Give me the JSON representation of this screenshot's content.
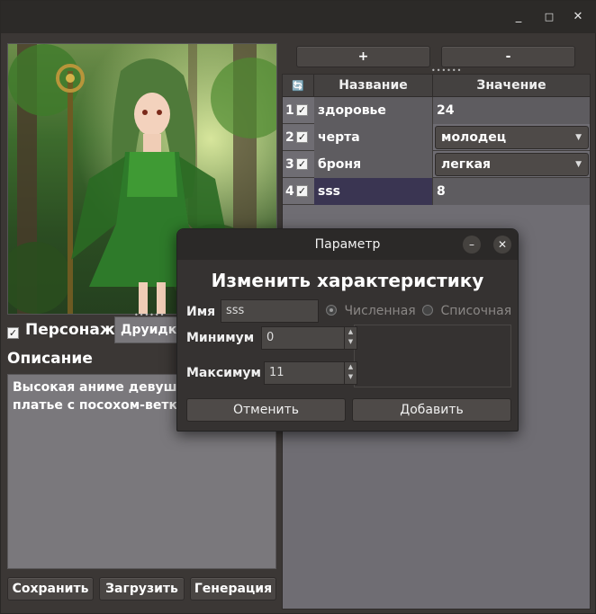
{
  "window": {
    "minimize_glyph": "_",
    "maximize_glyph": "□",
    "close_glyph": "✕"
  },
  "left": {
    "character_checkbox_checked": true,
    "character_label": "Персонаж",
    "character_type_value": "Друидка",
    "description_label": "Описание",
    "description_text": "Высокая аниме девушка\nплатье с посохом-веткой",
    "buttons": {
      "save": "Сохранить",
      "load": "Загрузить",
      "generate": "Генерация"
    }
  },
  "right": {
    "add_button": "+",
    "remove_button": "-",
    "headers": {
      "refresh_icon": "🔄",
      "name": "Название",
      "value": "Значение"
    },
    "rows": [
      {
        "index": "1",
        "checked": true,
        "name": "здоровье",
        "value": "24",
        "type": "text"
      },
      {
        "index": "2",
        "checked": true,
        "name": "черта",
        "value": "молодец",
        "type": "combo"
      },
      {
        "index": "3",
        "checked": true,
        "name": "броня",
        "value": "легкая",
        "type": "combo"
      },
      {
        "index": "4",
        "checked": true,
        "name": "sss",
        "value": "8",
        "type": "text"
      }
    ]
  },
  "dialog": {
    "title": "Параметр",
    "heading": "Изменить характеристику",
    "name_label": "Имя",
    "name_value": "sss",
    "radio_numeric": "Численная",
    "radio_list": "Списочная",
    "min_label": "Минимум",
    "min_value": "0",
    "max_label": "Максимум",
    "max_value": "11",
    "cancel_button": "Отменить",
    "add_button": "Добавить",
    "minimize_glyph": "–",
    "close_glyph": "✕"
  },
  "colors": {
    "accent_selected_row": "#3a3552",
    "table_bg": "#6f6d73",
    "dialog_bg": "#353231"
  }
}
